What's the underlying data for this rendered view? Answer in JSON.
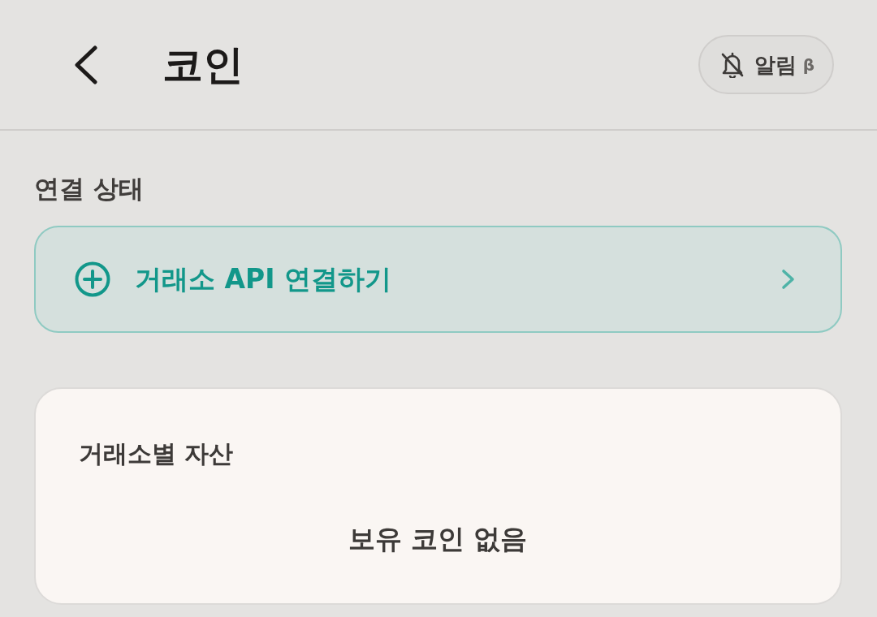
{
  "header": {
    "title": "코인",
    "alert_button": {
      "label": "알림",
      "badge": "β",
      "on": false
    }
  },
  "connection": {
    "heading": "연결 상태",
    "action": {
      "label": "거래소 API 연결하기"
    }
  },
  "assets": {
    "title": "거래소별 자산",
    "empty_message": "보유 코인 없음"
  }
}
